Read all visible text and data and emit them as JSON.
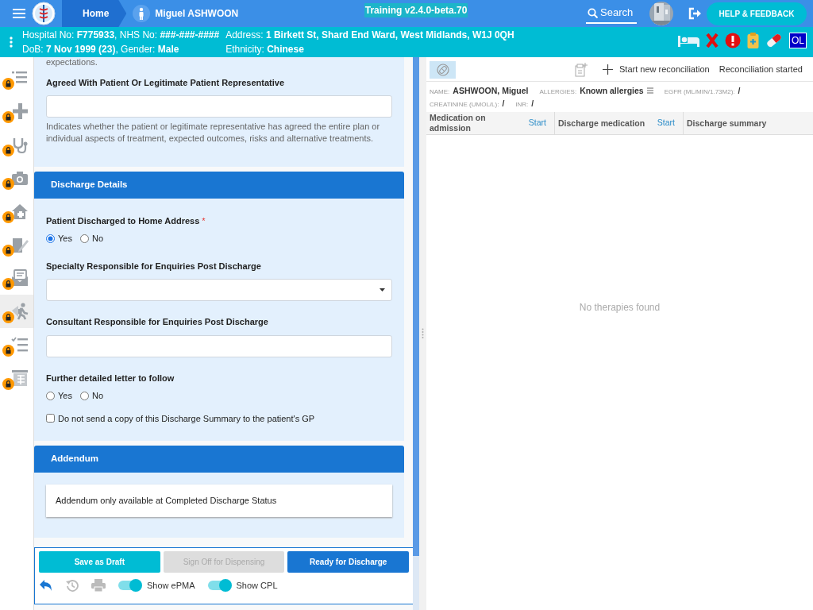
{
  "header": {
    "breadcrumbs": [
      {
        "label": "Home"
      },
      {
        "label": "Miguel ASHWOON"
      }
    ],
    "version": "Training v2.4.0-beta.70",
    "search": "Search",
    "help_button": "HELP & FEEDBACK"
  },
  "banner": {
    "lines": [
      "Hospital No: **F775933**, NHS No: **###-###-####**",
      "DoB: **7 Nov 1999 (23)**, Gender: **Male**",
      "Address: **1 Birkett St, Shard End Ward, West Midlands, W1J 0QH**",
      "Ethnicity: **Chinese**"
    ],
    "alerts": [
      {
        "kind": "bed"
      },
      {
        "kind": "cross"
      },
      {
        "kind": "alert"
      },
      {
        "kind": "clipboard"
      },
      {
        "kind": "pill"
      },
      {
        "kind": "badge",
        "label": "OL"
      }
    ]
  },
  "sidebar": [
    {
      "kind": "list",
      "selected": false
    },
    {
      "kind": "plus",
      "selected": false
    },
    {
      "kind": "stethoscope",
      "selected": false
    },
    {
      "kind": "camera",
      "selected": false
    },
    {
      "kind": "home",
      "selected": false
    },
    {
      "kind": "edit",
      "selected": false
    },
    {
      "kind": "mail",
      "selected": false
    },
    {
      "kind": "walk",
      "selected": true
    },
    {
      "kind": "checklist",
      "selected": false
    },
    {
      "kind": "table",
      "selected": false
    }
  ],
  "form": {
    "top_text": "expectations.",
    "agreed": {
      "label": "Agreed With Patient Or Legitimate Patient Representative",
      "help": "Indicates whether the patient or legitimate representative has agreed the entire plan or individual aspects of treatment, expected outcomes, risks and alternative treatments."
    },
    "discharge": {
      "title": "Discharge Details",
      "fields": [
        {
          "kind": "radio",
          "label": "Patient Discharged to Home Address",
          "required_mark": "*",
          "options": [
            {
              "label": "Yes",
              "selected": true
            },
            {
              "label": "No",
              "selected": false
            }
          ]
        },
        {
          "kind": "select",
          "label": "Specialty Responsible for Enquiries Post Discharge"
        },
        {
          "kind": "text",
          "label": "Consultant Responsible for Enquiries Post Discharge"
        },
        {
          "kind": "radio",
          "label": "Further detailed letter to follow",
          "options": [
            {
              "label": "Yes",
              "selected": false
            },
            {
              "label": "No",
              "selected": false
            }
          ]
        },
        {
          "kind": "checkbox",
          "label": "Do not send a copy of this Discharge Summary to the patient's GP",
          "checked": false
        }
      ]
    },
    "addendum": {
      "title": "Addendum",
      "note": "Addendum only available at Completed Discharge Status"
    }
  },
  "actions": {
    "buttons": [
      {
        "label": "Save as Draft",
        "kind": "draft",
        "disabled": false
      },
      {
        "label": "Sign Off for Dispensing",
        "kind": "sign",
        "disabled": true
      },
      {
        "label": "Ready for Discharge",
        "kind": "ready",
        "disabled": false
      }
    ],
    "toggles": [
      {
        "label": "Show ePMA",
        "on": true
      },
      {
        "label": "Show CPL",
        "on": true
      }
    ]
  },
  "reconciliation": {
    "start_label": "Start new reconciliation",
    "status": "Reconciliation started",
    "info": [
      {
        "label": "NAME:",
        "value": "ASHWOON, Miguel"
      },
      {
        "label": "ALLERGIES:",
        "value": "Known allergies"
      },
      {
        "label": "EGFR (ML/MIN/1.73M2):",
        "value": "/"
      },
      {
        "label": "CREATININE (UMOL/L):",
        "value": "/"
      },
      {
        "label": "INR:",
        "value": "/"
      }
    ],
    "columns": [
      {
        "label": "Medication on admission",
        "action": "Start"
      },
      {
        "label": "Discharge medication",
        "action": "Start"
      },
      {
        "label": "Discharge summary"
      }
    ],
    "empty": "No therapies found"
  }
}
